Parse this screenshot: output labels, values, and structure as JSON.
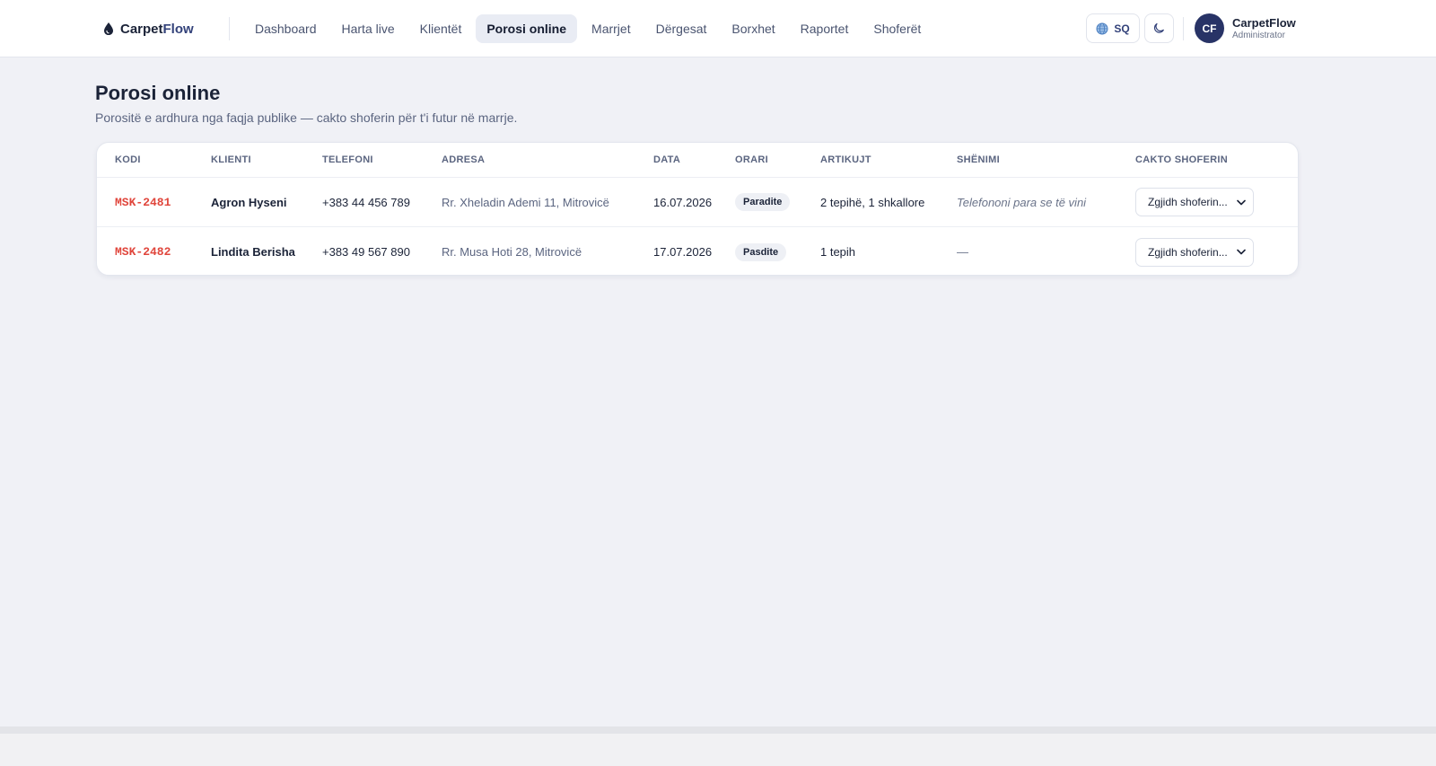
{
  "brand": {
    "name_part1": "Carpet",
    "name_part2": "Flow"
  },
  "nav": {
    "items": [
      {
        "label": "Dashboard"
      },
      {
        "label": "Harta live"
      },
      {
        "label": "Klientët"
      },
      {
        "label": "Porosi online",
        "active": true
      },
      {
        "label": "Marrjet"
      },
      {
        "label": "Dërgesat"
      },
      {
        "label": "Borxhet"
      },
      {
        "label": "Raportet"
      },
      {
        "label": "Shoferët"
      }
    ]
  },
  "header": {
    "language": "SQ",
    "language_icon": "globe-icon",
    "theme_icon": "moon-icon",
    "user": {
      "initials": "CF",
      "name": "CarpetFlow",
      "role": "Administrator"
    }
  },
  "page": {
    "title": "Porosi online",
    "subtitle": "Porositë e ardhura nga faqja publike — cakto shoferin për t'i futur në marrje."
  },
  "table": {
    "columns": [
      "KODI",
      "KLIENTI",
      "TELEFONI",
      "ADRESA",
      "DATA",
      "ORARI",
      "ARTIKUJT",
      "SHËNIMI",
      "CAKTO SHOFERIN"
    ],
    "rows": [
      {
        "code": "MSK-2481",
        "client": "Agron Hyseni",
        "phone": "+383 44 456 789",
        "address": "Rr. Xheladin Ademi 11, Mitrovicë",
        "date": "16.07.2026",
        "slot": "Paradite",
        "items": "2 tepihë, 1 shkallore",
        "note": "Telefononi para se të vini",
        "driver_select": "Zgjidh shoferin..."
      },
      {
        "code": "MSK-2482",
        "client": "Lindita Berisha",
        "phone": "+383 49 567 890",
        "address": "Rr. Musa Hoti 28, Mitrovicë",
        "date": "17.07.2026",
        "slot": "Pasdite",
        "items": "1 tepih",
        "note": "—",
        "driver_select": "Zgjidh shoferin..."
      }
    ]
  },
  "colors": {
    "accent": "#283366",
    "code": "#e0463c",
    "background": "#f0f1f6"
  }
}
